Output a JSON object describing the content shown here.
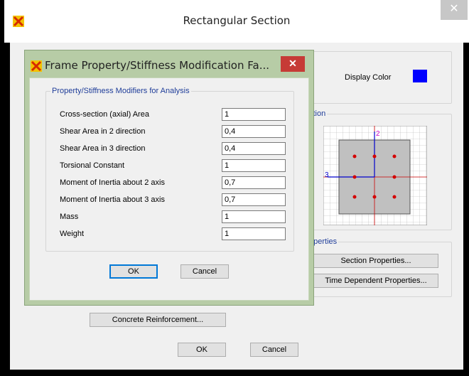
{
  "outer": {
    "title": "Rectangular Section",
    "display_color_label": "Display Color",
    "display_color": "#0000ff",
    "section_group_label": "ction",
    "properties_group_label": "operties",
    "section_properties_btn": "Section Properties...",
    "time_dependent_btn": "Time Dependent Properties...",
    "concrete_btn": "Concrete Reinforcement...",
    "ok": "OK",
    "cancel": "Cancel",
    "axis_2": "2",
    "axis_3": "3"
  },
  "dialog": {
    "title": "Frame Property/Stiffness Modification Fa...",
    "group_label": "Property/Stiffness Modifiers for Analysis",
    "rows": [
      {
        "label": "Cross-section (axial) Area",
        "value": "1"
      },
      {
        "label": "Shear Area in 2 direction",
        "value": "0,4"
      },
      {
        "label": "Shear Area in 3 direction",
        "value": "0,4"
      },
      {
        "label": "Torsional Constant",
        "value": "1"
      },
      {
        "label": "Moment of Inertia about 2 axis",
        "value": "0,7"
      },
      {
        "label": "Moment of Inertia about 3 axis",
        "value": "0,7"
      },
      {
        "label": "Mass",
        "value": "1"
      },
      {
        "label": "Weight",
        "value": "1"
      }
    ],
    "ok": "OK",
    "cancel": "Cancel"
  }
}
